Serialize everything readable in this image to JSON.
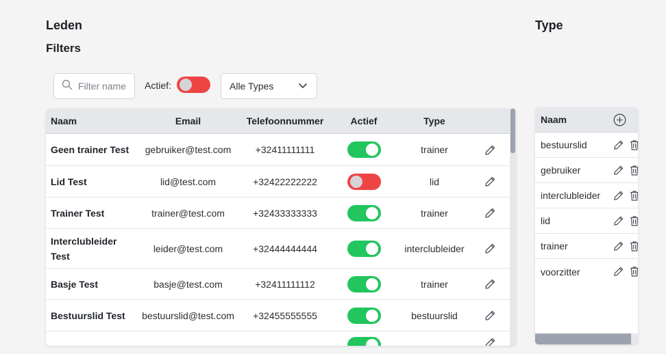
{
  "page": {
    "title": "Leden",
    "filters_title": "Filters",
    "type_title": "Type"
  },
  "filters": {
    "search_placeholder": "Filter name",
    "actief_label": "Actief:",
    "actief_on": false,
    "type_select_value": "Alle Types"
  },
  "members_table": {
    "columns": [
      "Naam",
      "Email",
      "Telefoonnummer",
      "Actief",
      "Type"
    ],
    "rows": [
      {
        "name": "Geen trainer Test",
        "email": "gebruiker@test.com",
        "phone": "+32411111111",
        "active": true,
        "type": "trainer"
      },
      {
        "name": "Lid Test",
        "email": "lid@test.com",
        "phone": "+32422222222",
        "active": false,
        "type": "lid"
      },
      {
        "name": "Trainer Test",
        "email": "trainer@test.com",
        "phone": "+32433333333",
        "active": true,
        "type": "trainer"
      },
      {
        "name": "Interclubleider Test",
        "email": "leider@test.com",
        "phone": "+32444444444",
        "active": true,
        "type": "interclubleider"
      },
      {
        "name": "Basje Test",
        "email": "basje@test.com",
        "phone": "+32411111112",
        "active": true,
        "type": "trainer"
      },
      {
        "name": "Bestuurslid Test",
        "email": "bestuurslid@test.com",
        "phone": "+32455555555",
        "active": true,
        "type": "bestuurslid"
      },
      {
        "name": "",
        "email": "",
        "phone": "",
        "active": true,
        "type": ""
      }
    ]
  },
  "types_table": {
    "column": "Naam",
    "rows": [
      "bestuurslid",
      "gebruiker",
      "interclubleider",
      "lid",
      "trainer",
      "voorzitter"
    ]
  },
  "colors": {
    "toggle_on": "#22c55e",
    "toggle_off": "#ef4444"
  },
  "icons": {
    "search": "search-icon",
    "chevron": "chevron-down-icon",
    "edit": "pencil-icon",
    "delete": "trash-icon",
    "add": "plus-circle-icon"
  }
}
